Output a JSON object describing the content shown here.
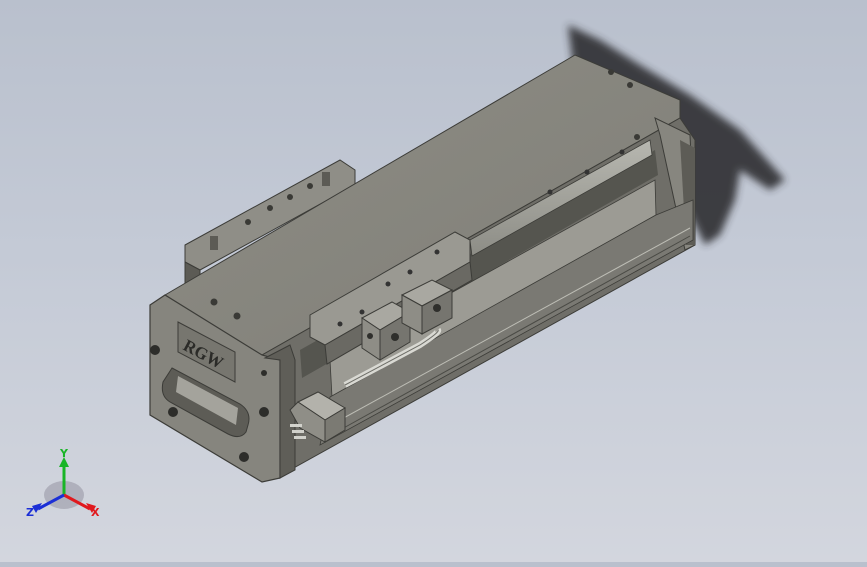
{
  "viewport": {
    "background_top": "#b9c0cd",
    "background_bottom": "#d3d6de"
  },
  "model": {
    "logo_text": "RGW",
    "body_color": "#7d7c74",
    "top_color": "#8a8980",
    "dark_color": "#4c4c46",
    "rail_color": "#a9a9a2"
  },
  "triad": {
    "x_label": "X",
    "y_label": "Y",
    "z_label": "Z",
    "x_color": "#e0191e",
    "y_color": "#19b526",
    "z_color": "#1b2fd6"
  }
}
